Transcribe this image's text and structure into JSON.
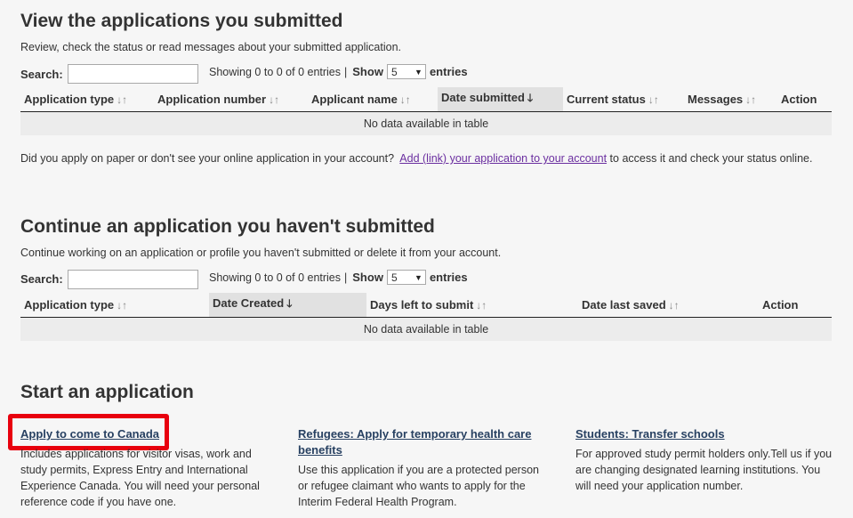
{
  "submitted": {
    "title": "View the applications you submitted",
    "description": "Review, check the status or read messages about your submitted application.",
    "search_label": "Search:",
    "showing": "Showing 0 to 0 of 0 entries",
    "separator": "|",
    "show_label": "Show",
    "page_size": "5",
    "entries_label": "entries",
    "columns": [
      "Application type",
      "Application number",
      "Applicant name",
      "Date submitted",
      "Current status",
      "Messages",
      "Action"
    ],
    "empty": "No data available in table"
  },
  "paper_note": {
    "before": "Did you apply on paper or don't see your online application in your account?",
    "link": "Add (link) your application to your account",
    "after": "to access it and check your status online."
  },
  "unsubmitted": {
    "title": "Continue an application you haven't submitted",
    "description": "Continue working on an application or profile you haven't submitted or delete it from your account.",
    "search_label": "Search:",
    "showing": "Showing 0 to 0 of 0 entries",
    "separator": "|",
    "show_label": "Show",
    "page_size": "5",
    "entries_label": "entries",
    "columns": [
      "Application type",
      "Date Created",
      "Days left to submit",
      "Date last saved",
      "Action"
    ],
    "empty": "No data available in table"
  },
  "start": {
    "title": "Start an application",
    "cards": [
      {
        "link": "Apply to come to Canada",
        "text": "Includes applications for visitor visas, work and study permits, Express Entry and International Experience Canada. You will need your personal reference code if you have one."
      },
      {
        "link": "Refugees: Apply for temporary health care benefits",
        "text": "Use this application if you are a protected person or refugee claimant who wants to apply for the Interim Federal Health Program."
      },
      {
        "link": "Students: Transfer schools",
        "text": "For approved study permit holders only.Tell us if you are changing designated learning institutions. You will need your application number."
      }
    ]
  },
  "icons": {
    "sort": "sort-both-icon",
    "sorted_desc": "sort-down-icon",
    "dropdown": "chevron-down-icon"
  },
  "colors": {
    "background": "#f6f6f6",
    "link": "#284162",
    "visited_link": "#6b2fa0",
    "highlight": "#e8000e",
    "sorted_header": "#e1e1e1"
  }
}
